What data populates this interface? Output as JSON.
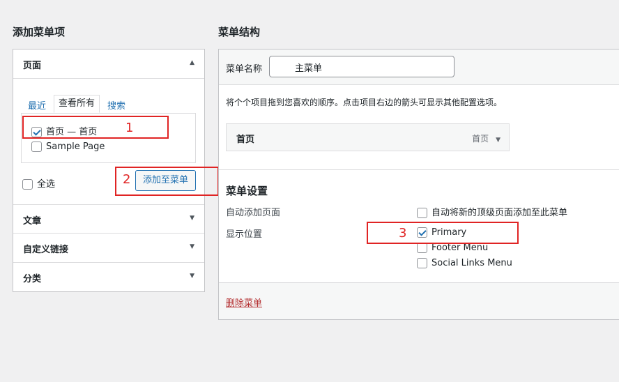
{
  "left": {
    "heading": "添加菜单项",
    "sections": {
      "pages": "页面",
      "posts": "文章",
      "custom_links": "自定义链接",
      "categories": "分类"
    },
    "tabs": {
      "recent": "最近",
      "view_all": "查看所有",
      "search": "搜索"
    },
    "items": [
      {
        "label": "首页 — 首页",
        "checked": true
      },
      {
        "label": "Sample Page",
        "checked": false
      }
    ],
    "select_all": "全选",
    "add_button": "添加至菜单"
  },
  "right": {
    "heading": "菜单结构",
    "menu_name_label": "菜单名称",
    "menu_name_value": "主菜单",
    "instructions": "将个个项目拖到您喜欢的顺序。点击项目右边的箭头可显示其他配置选项。",
    "menu_item": {
      "title": "首页",
      "type": "首页"
    },
    "settings_heading": "菜单设置",
    "auto_add_label": "自动添加页面",
    "auto_add_option": "自动将新的顶级页面添加至此菜单",
    "display_location_label": "显示位置",
    "locations": [
      {
        "label": "Primary",
        "checked": true
      },
      {
        "label": "Footer Menu",
        "checked": false
      },
      {
        "label": "Social Links Menu",
        "checked": false
      }
    ],
    "delete_menu": "删除菜单"
  },
  "annotations": {
    "n1": "1",
    "n2": "2",
    "n3": "3"
  },
  "colors": {
    "accent": "#2271b1",
    "annotation": "#e02424",
    "danger": "#b32d2e"
  }
}
